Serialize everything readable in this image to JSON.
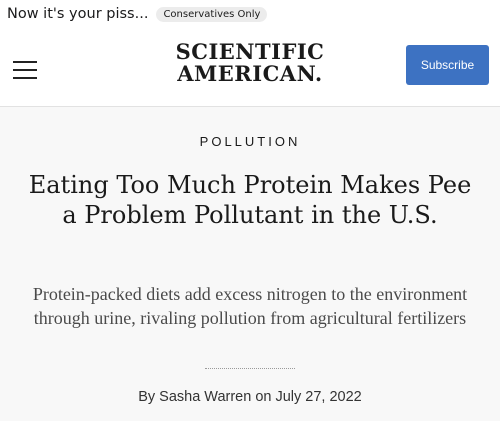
{
  "post": {
    "title": "Now it's your piss...",
    "flair": "Conservatives Only"
  },
  "site": {
    "logo_line1": "SCIENTIFIC",
    "logo_line2": "AMERICAN.",
    "subscribe_label": "Subscribe"
  },
  "article": {
    "category": "POLLUTION",
    "headline": "Eating Too Much Protein Makes Pee a Problem Pollutant in the U.S.",
    "dek": "Protein-packed diets add excess nitrogen to the environment through urine, rivaling pollution from agricultural fertilizers",
    "byline": "By Sasha Warren on July 27, 2022"
  },
  "icons": {
    "menu": "hamburger-menu-icon"
  },
  "colors": {
    "subscribe_bg": "#3d72c2",
    "article_bg": "#f8f8f8"
  }
}
